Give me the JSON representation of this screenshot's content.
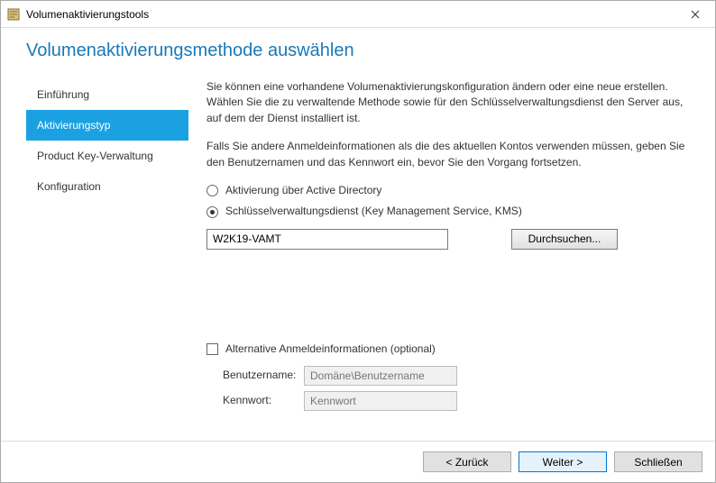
{
  "window": {
    "title": "Volumenaktivierungstools"
  },
  "page": {
    "title": "Volumenaktivierungsmethode auswählen"
  },
  "sidebar": {
    "items": [
      {
        "label": "Einführung"
      },
      {
        "label": "Aktivierungstyp"
      },
      {
        "label": "Product Key-Verwaltung"
      },
      {
        "label": "Konfiguration"
      }
    ],
    "selectedIndex": 1
  },
  "main": {
    "para1": "Sie können eine vorhandene Volumenaktivierungskonfiguration ändern oder eine neue erstellen. Wählen Sie die zu verwaltende Methode sowie für den Schlüsselverwaltungsdienst den Server aus, auf dem der Dienst installiert ist.",
    "para2": "Falls Sie andere Anmeldeinformationen als die des aktuellen Kontos verwenden müssen, geben Sie den Benutzernamen und das Kennwort ein, bevor Sie den Vorgang fortsetzen.",
    "radio_ad": "Aktivierung über Active Directory",
    "radio_kms": "Schlüsselverwaltungsdienst (Key Management Service, KMS)",
    "server_value": "W2K19-VAMT",
    "browse_label": "Durchsuchen...",
    "alt_creds_label": "Alternative Anmeldeinformationen (optional)",
    "username_label": "Benutzername:",
    "username_placeholder": "Domäne\\Benutzername",
    "password_label": "Kennwort:",
    "password_placeholder": "Kennwort"
  },
  "footer": {
    "back": "< Zurück",
    "next": "Weiter >",
    "close": "Schließen"
  }
}
